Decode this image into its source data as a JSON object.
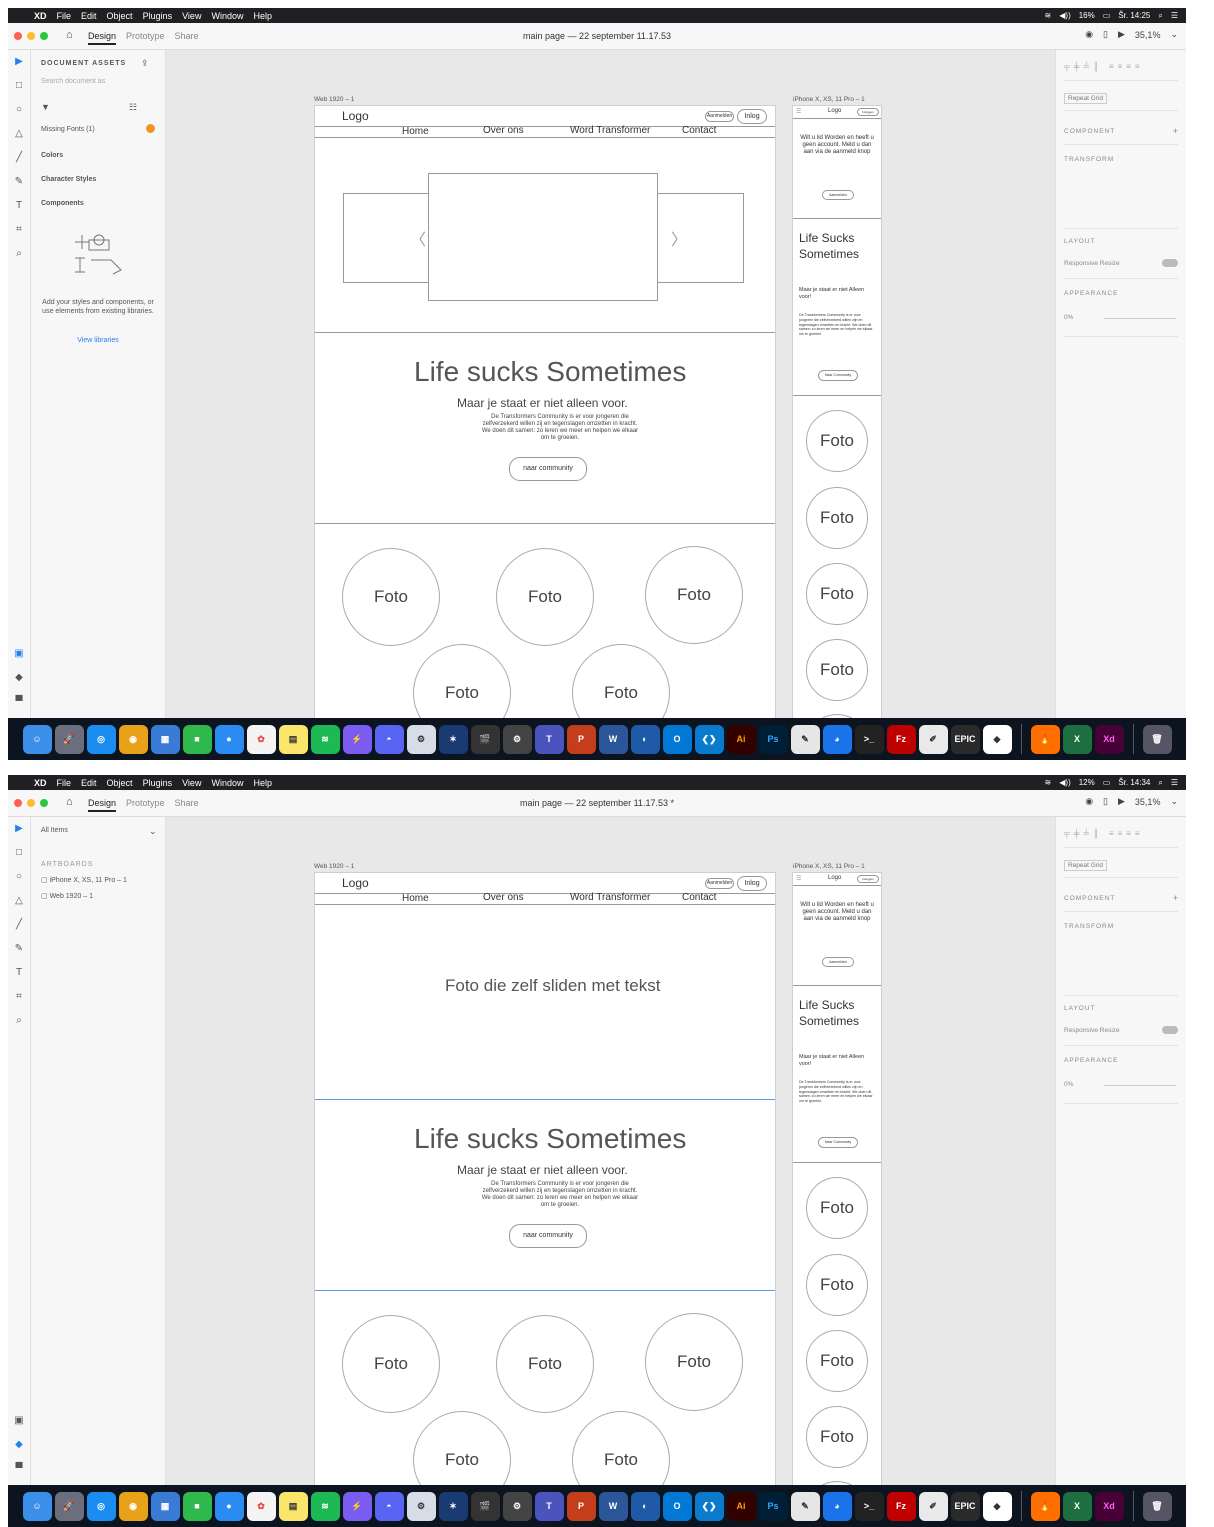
{
  "screenshots": [
    {
      "menubar": {
        "items": [
          "XD",
          "File",
          "Edit",
          "Object",
          "Plugins",
          "View",
          "Window",
          "Help"
        ],
        "battery": "16%",
        "clock": "Šr. 14:25"
      },
      "titlebar": {
        "tabs": [
          "Design",
          "Prototype",
          "Share"
        ],
        "doc_title": "main page — 22 september 11.17.53",
        "zoom": "35,1%"
      },
      "left_panel": {
        "header": "DOCUMENT ASSETS",
        "search_placeholder": "Search document as",
        "missing_fonts": "Missing Fonts (1)",
        "sections": [
          "Colors",
          "Character Styles",
          "Components"
        ],
        "empty_text": "Add your styles and components, or use elements from existing libraries.",
        "link": "View libraries"
      },
      "artboards": {
        "web_label": "Web 1920 – 1",
        "phone_label": "iPhone X, XS, 11 Pro – 1",
        "logo": "Logo",
        "nav": [
          "Home",
          "Over ons",
          "Word Transformer",
          "Contact"
        ],
        "btn_register": "Aanmelden",
        "btn_login": "Inlog",
        "hero_title": "Life sucks Sometimes",
        "hero_sub": "Maar je staat er niet alleen voor.",
        "hero_body": "De Transformers Community is er voor jongeren die zelfverzekerd willen zij en tegenslagen omzetten in kracht. We doen dit samen: zo leren we meer en helpen we elkaar om te groeien.",
        "hero_button": "naar community",
        "photo": "Foto",
        "phone_logo": "Logo",
        "phone_login": "Inloggen",
        "phone_intro": "Wilt u lid Worden en heeft u geen account. Meld u dan aan via de aanmeld knop",
        "phone_register": "Aanmelden",
        "phone_title": "Life Sucks Sometimes",
        "phone_sub": "Maar je staat er niet Alleen voor!",
        "phone_body": "De Transformers Community is er voor jongeren die zelfverzekerd willen zijn en tegenslagen omzetten en kracht. We doen dit samen: zo leren we meer en helpen we elkaar om te groeien.",
        "phone_button": "Naar Community"
      },
      "right_panel": {
        "repeat_grid": "Repeat Grid",
        "component": "COMPONENT",
        "transform": "TRANSFORM",
        "layout": "LAYOUT",
        "responsive": "Responsive Resize",
        "appearance": "APPEARANCE",
        "opacity": "0%"
      }
    },
    {
      "menubar": {
        "items": [
          "XD",
          "File",
          "Edit",
          "Object",
          "Plugins",
          "View",
          "Window",
          "Help"
        ],
        "battery": "12%",
        "clock": "Šr. 14:34"
      },
      "titlebar": {
        "tabs": [
          "Design",
          "Prototype",
          "Share"
        ],
        "doc_title": "main page — 22 september 11.17.53 *",
        "zoom": "35,1%"
      },
      "left_panel": {
        "search_placeholder": "All Items",
        "artboards_header": "ARTBOARDS",
        "artboard_items": [
          "iPhone X, XS, 11 Pro – 1",
          "Web 1920 – 1"
        ]
      },
      "artboards": {
        "slider_text": "Foto die zelf sliden met tekst"
      }
    }
  ]
}
